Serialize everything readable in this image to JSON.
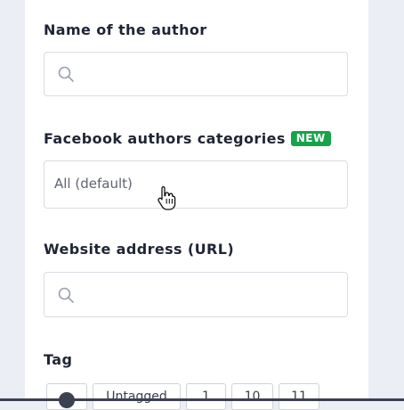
{
  "form": {
    "author_name": {
      "label": "Name of the author",
      "value": "",
      "icon": "search-icon"
    },
    "facebook_categories": {
      "label": "Facebook authors categories",
      "badge": "NEW",
      "value": "All (default)"
    },
    "website": {
      "label": "Website address (URL)",
      "value": "",
      "icon": "search-icon"
    },
    "tag": {
      "label": "Tag",
      "options": [
        "Untagged",
        "1",
        "10",
        "11"
      ]
    }
  },
  "colors": {
    "badge": "#16a34a",
    "panel": "#ffffff",
    "background": "#eceef6"
  }
}
